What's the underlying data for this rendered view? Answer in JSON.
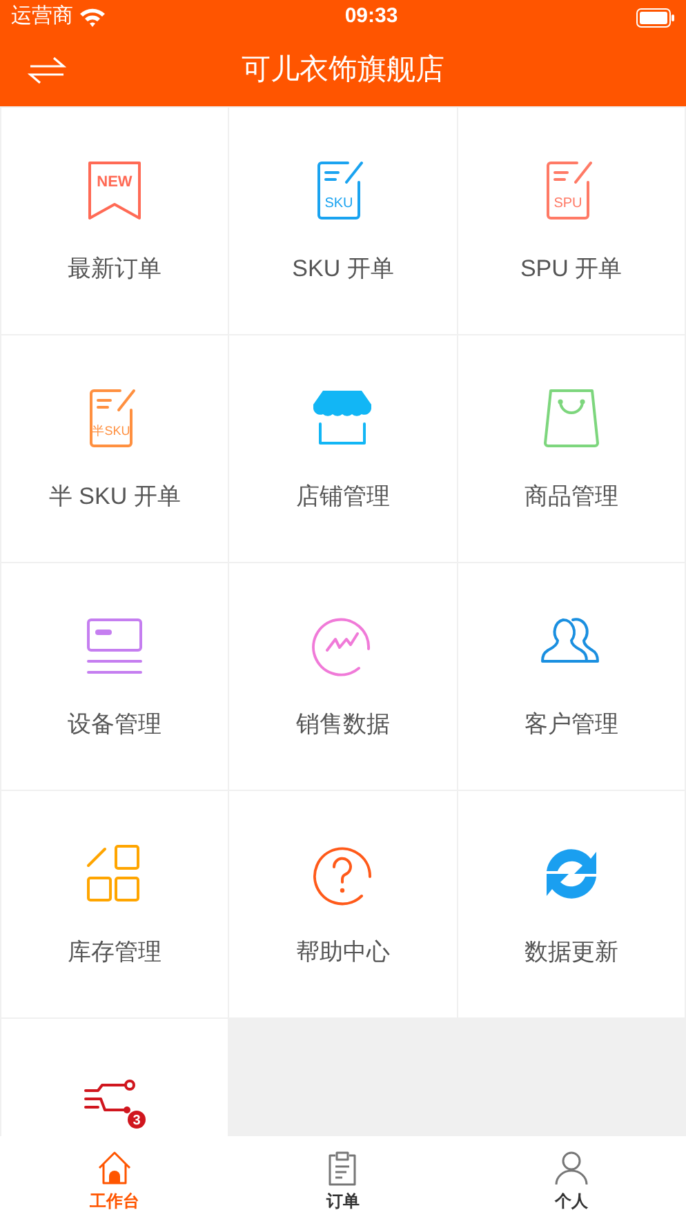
{
  "status_bar": {
    "carrier": "运营商",
    "time": "09:33"
  },
  "nav_bar": {
    "title": "可儿衣饰旗舰店"
  },
  "tiles": [
    {
      "kind": "ribbon",
      "icon_text": "NEW",
      "color": "#ff6a55",
      "label": "最新订单"
    },
    {
      "kind": "doc",
      "icon_text": "SKU",
      "color": "#1aa3f0",
      "label": "SKU 开单"
    },
    {
      "kind": "doc",
      "icon_text": "SPU",
      "color": "#ff7a66",
      "label": "SPU 开单"
    },
    {
      "kind": "doc",
      "icon_text": "半SKU",
      "color": "#ff9040",
      "label": "半 SKU 开单"
    },
    {
      "kind": "store",
      "color": "#12b6f5",
      "label": "店铺管理"
    },
    {
      "kind": "bag",
      "color": "#7dd67d",
      "label": "商品管理"
    },
    {
      "kind": "device",
      "color": "#c57ef0",
      "label": "设备管理"
    },
    {
      "kind": "chart",
      "color": "#f07ad8",
      "label": "销售数据"
    },
    {
      "kind": "users",
      "color": "#1a8fe0",
      "label": "客户管理"
    },
    {
      "kind": "blocks",
      "color": "#ffa500",
      "label": "库存管理"
    },
    {
      "kind": "help",
      "color": "#ff5a1a",
      "label": "帮助中心"
    },
    {
      "kind": "refresh",
      "color": "#1a9ff0",
      "label": "数据更新"
    },
    {
      "kind": "circuit",
      "icon_text": "3",
      "color": "#d0161e"
    }
  ],
  "tab_bar": [
    {
      "kind": "home",
      "label": "工作台",
      "selected": true
    },
    {
      "kind": "clipboard",
      "label": "订单",
      "selected": false
    },
    {
      "kind": "person",
      "label": "个人",
      "selected": false
    }
  ]
}
